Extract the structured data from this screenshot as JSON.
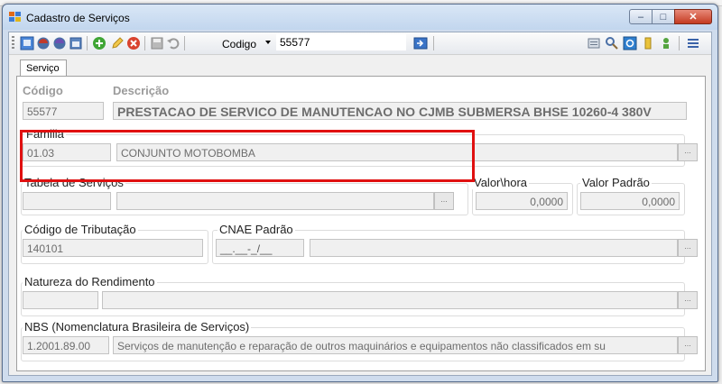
{
  "window": {
    "title": "Cadastro de Serviços",
    "min": "‒",
    "max": "□",
    "close": "✕"
  },
  "toolbar": {
    "codigo_label": "Codigo",
    "codigo_value": "55577"
  },
  "tab": {
    "label": "Serviço"
  },
  "codigo": {
    "label": "Código",
    "value": "55577"
  },
  "descricao": {
    "label": "Descrição",
    "value": "PRESTACAO DE SERVICO DE MANUTENCAO NO CJMB SUBMERSA BHSE 10260-4 380V"
  },
  "familia": {
    "label": "Familia",
    "code": "01.03",
    "name": "CONJUNTO MOTOBOMBA"
  },
  "tabela_servicos": {
    "label": "Tabela de Serviços",
    "code": "",
    "name": ""
  },
  "valor_hora": {
    "label": "Valor\\hora",
    "value": "0,0000"
  },
  "valor_padrao": {
    "label": "Valor Padrão",
    "value": "0,0000"
  },
  "tributacao": {
    "label": "Código de Tributação",
    "value": "140101"
  },
  "cnae": {
    "label": "CNAE Padrão",
    "mask": "__.__-_/__",
    "desc": ""
  },
  "natureza": {
    "label": "Natureza do Rendimento",
    "code": "",
    "desc": ""
  },
  "nbs": {
    "label": "NBS (Nomenclatura Brasileira de Serviços)",
    "code": "1.2001.89.00",
    "desc": "Serviços de manutenção e reparação de outros maquinários e equipamentos não classificados em su"
  },
  "ellipsis": "..."
}
